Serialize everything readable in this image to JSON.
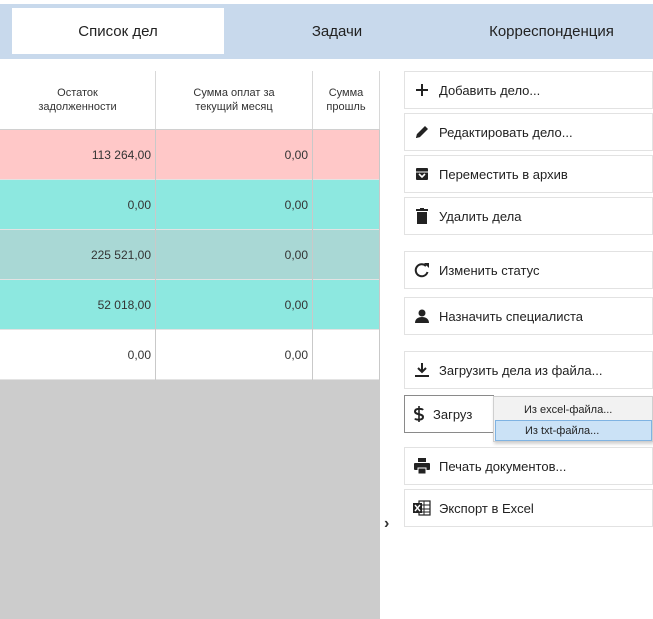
{
  "tabs": [
    {
      "label": "Список дел",
      "active": true
    },
    {
      "label": "Задачи",
      "active": false
    },
    {
      "label": "Корреспонденция",
      "active": false
    }
  ],
  "grid": {
    "headers": [
      "Остаток\nзадолженности",
      "Сумма оплат за\nтекущий месяц",
      "Сумма\nпрошль"
    ],
    "rows": [
      {
        "cells": [
          "113 264,00",
          "0,00",
          ""
        ],
        "color": "#ffc8c8"
      },
      {
        "cells": [
          "0,00",
          "0,00",
          ""
        ],
        "color": "#8de8e0"
      },
      {
        "cells": [
          "225 521,00",
          "0,00",
          ""
        ],
        "color": "#a9d8d5"
      },
      {
        "cells": [
          "52 018,00",
          "0,00",
          ""
        ],
        "color": "#8de8e0"
      },
      {
        "cells": [
          "0,00",
          "0,00",
          ""
        ],
        "color": "#ffffff"
      }
    ],
    "empty_color": "#cccccc"
  },
  "menu": {
    "add": "Добавить дело...",
    "edit": "Редактировать дело...",
    "archive": "Переместить в архив",
    "delete": "Удалить дела",
    "status": "Изменить статус",
    "assign": "Назначить специалиста",
    "upload": "Загрузить дела из файла...",
    "payments": "Загруз",
    "print": "Печать документов...",
    "export": "Экспорт в Excel"
  },
  "submenu": {
    "excel": "Из excel-файла...",
    "txt": "Из txt-файла..."
  },
  "icons": {
    "add": "plus-icon",
    "edit": "pencil-icon",
    "archive": "archive-icon",
    "delete": "trash-icon",
    "status": "refresh-icon",
    "assign": "person-icon",
    "upload": "download-icon",
    "payments": "dollar-icon",
    "print": "printer-icon",
    "export": "excel-icon",
    "expand": "chevron-right-icon"
  },
  "expand_glyph": "›"
}
